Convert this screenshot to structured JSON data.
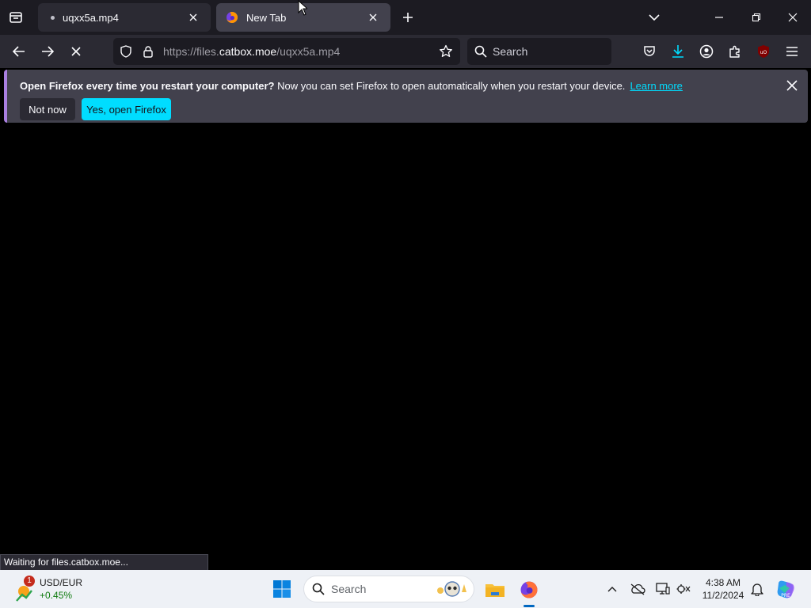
{
  "tabs": [
    {
      "title": "uqxx5a.mp4",
      "active": false,
      "loading": true
    },
    {
      "title": "New Tab",
      "active": true,
      "favicon": "firefox-icon"
    }
  ],
  "nav": {
    "url_prefix": "https://files.",
    "url_host": "catbox.moe",
    "url_path": "/uqxx5a.mp4",
    "search_placeholder": "Search"
  },
  "notification": {
    "bold_text": "Open Firefox every time you restart your computer?",
    "text": " Now you can set Firefox to open automatically when you restart your device.",
    "link": "Learn more",
    "btn_secondary": "Not now",
    "btn_primary": "Yes, open Firefox"
  },
  "status_text": "Waiting for files.catbox.moe...",
  "taskbar": {
    "ticker_name": "USD/EUR",
    "ticker_change": "+0.45%",
    "ticker_badge": "1",
    "search_placeholder": "Search",
    "time": "4:38 AM",
    "date": "11/2/2024"
  },
  "colors": {
    "accent": "#00ddff",
    "tab_active": "#42414d",
    "toolbar": "#2b2a33",
    "frame": "#1c1b22",
    "notice_border": "#a97fe0"
  }
}
